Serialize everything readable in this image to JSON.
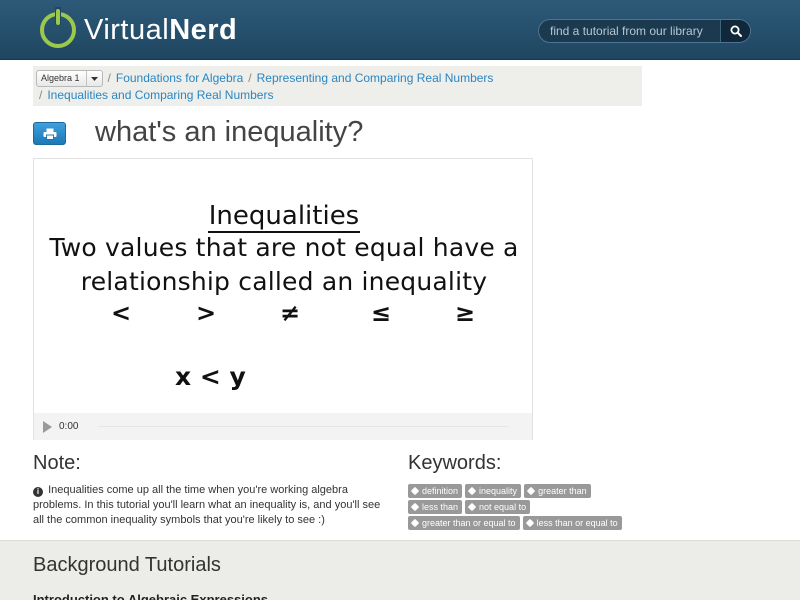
{
  "header": {
    "logo_virtual": "Virtual",
    "logo_nerd": "Nerd",
    "search_placeholder": "find a tutorial from our library",
    "search_icon": "search-icon"
  },
  "breadcrumb": {
    "course_select": "Algebra 1",
    "items": [
      "Foundations for Algebra",
      "Representing and Comparing Real Numbers",
      "Inequalities and Comparing Real Numbers"
    ],
    "separator": "/"
  },
  "page": {
    "title": "what's an inequality?",
    "print_icon": "printer-icon"
  },
  "video": {
    "slide_heading": "Inequalities",
    "slide_line1": "Two values that are not equal have a",
    "slide_line2": "relationship called an inequality",
    "symbols": [
      "<",
      ">",
      "≠",
      "≤",
      "≥"
    ],
    "example": "x < y",
    "time": "0:00",
    "play_icon": "play-icon"
  },
  "note": {
    "title": "Note:",
    "text": "Inequalities come up all the time when you're working algebra problems. In this tutorial you'll learn what an inequality is, and you'll see all the common inequality symbols that you're likely to see :)",
    "icon": "info-icon"
  },
  "keywords": {
    "title": "Keywords:",
    "tags": [
      "definition",
      "inequality",
      "greater than",
      "less than",
      "not equal to",
      "greater than or equal to",
      "less than or equal to"
    ],
    "tag_icon": "tag-icon"
  },
  "background": {
    "title": "Background Tutorials",
    "link": "Introduction to Algebraic Expressions"
  },
  "colors": {
    "header_bg": "#1f4661",
    "logo_green": "#9cc94b",
    "link_blue": "#2a86c4",
    "print_button": "#2a8ccc",
    "tag_gray": "#999999",
    "section_bg": "#ecece8"
  }
}
